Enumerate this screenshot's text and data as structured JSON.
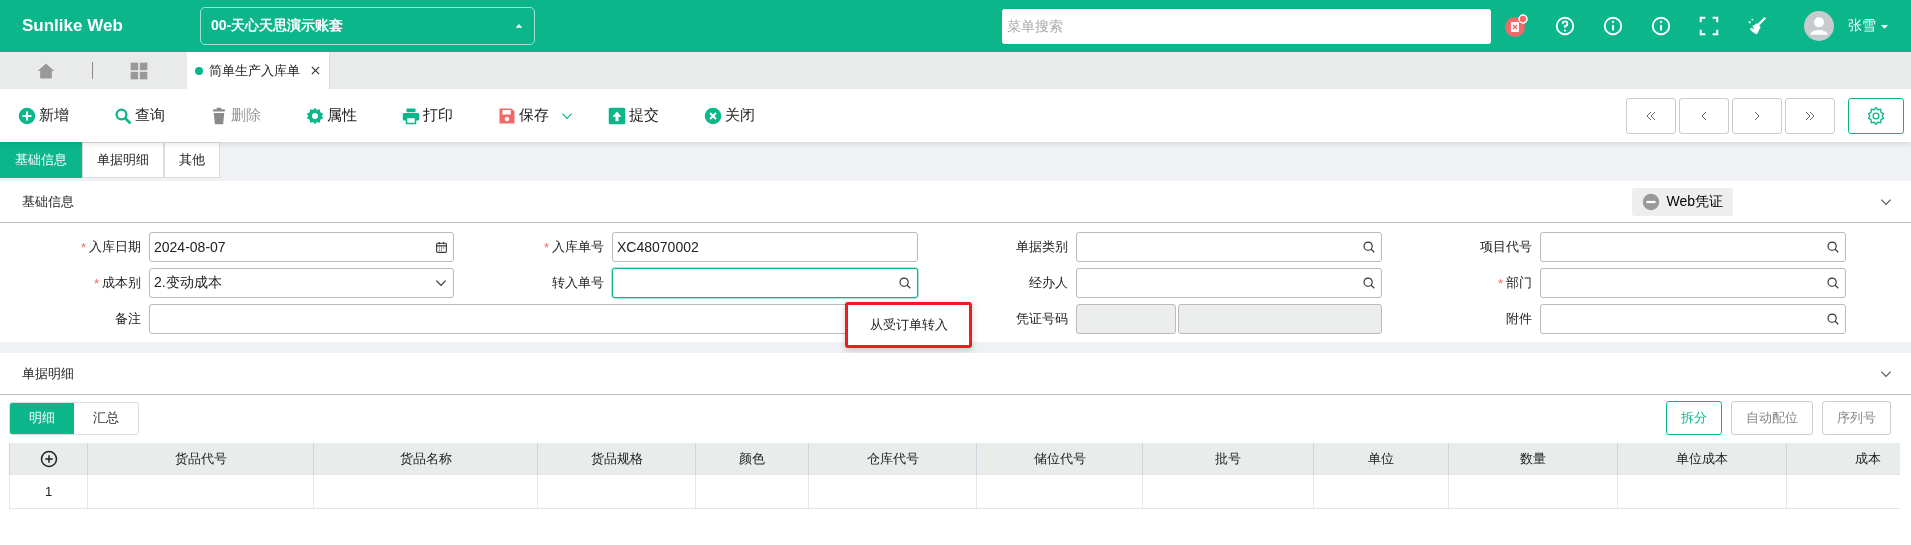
{
  "header": {
    "logo": "Sunlike Web",
    "account": "00-天心天思演示账套",
    "search": {
      "placeholder": "菜单搜索"
    },
    "user": "张雪"
  },
  "doc_tabs": [
    {
      "label": "简单生产入库单",
      "selected": true
    }
  ],
  "toolbar": [
    {
      "kind": "add",
      "label": "新增",
      "disabled": false,
      "dropdown": false
    },
    {
      "kind": "query",
      "label": "查询",
      "disabled": false,
      "dropdown": false
    },
    {
      "kind": "delete",
      "label": "删除",
      "disabled": true,
      "dropdown": false
    },
    {
      "kind": "props",
      "label": "属性",
      "disabled": false,
      "dropdown": false
    },
    {
      "kind": "print",
      "label": "打印",
      "disabled": false,
      "dropdown": false
    },
    {
      "kind": "save",
      "label": "保存",
      "disabled": false,
      "dropdown": true
    },
    {
      "kind": "submit",
      "label": "提交",
      "disabled": false,
      "dropdown": false
    },
    {
      "kind": "close",
      "label": "关闭",
      "disabled": false,
      "dropdown": false
    }
  ],
  "form_tabs": [
    {
      "label": "基础信息",
      "selected": true
    },
    {
      "label": "单据明细",
      "selected": false
    },
    {
      "label": "其他",
      "selected": false
    }
  ],
  "basic_section": {
    "title": "基础信息",
    "voucher_button": "Web凭证",
    "expanded": true,
    "fields": [
      {
        "label": "入库日期",
        "kind": "date",
        "required_mark": "*",
        "value": "2024-08-07",
        "focused": false
      },
      {
        "label": "入库单号",
        "kind": "text",
        "required_mark": "*",
        "value": "XC48070002",
        "focused": false
      },
      {
        "label": "单据类别",
        "kind": "lookup",
        "focused": false
      },
      {
        "label": "项目代号",
        "kind": "lookup",
        "focused": false
      },
      {
        "label": "成本别",
        "kind": "select",
        "required_mark": "*",
        "value": "2.变动成本",
        "focused": false
      },
      {
        "label": "转入单号",
        "kind": "lookup",
        "focused": true
      },
      {
        "label": "经办人",
        "kind": "lookup",
        "focused": false
      },
      {
        "label": "部门",
        "kind": "lookup",
        "required_mark": "*",
        "focused": false
      },
      {
        "label": "备注",
        "kind": "wide",
        "focused": false
      },
      {
        "label": "凭证号码",
        "kind": "split",
        "focused": false
      },
      {
        "label": "附件",
        "kind": "lookup",
        "focused": false
      }
    ],
    "popup_menu": [
      "从受订单转入"
    ]
  },
  "detail_section": {
    "title": "单据明细",
    "expanded": true,
    "tabs": [
      {
        "label": "明细",
        "selected": true
      },
      {
        "label": "汇总",
        "selected": false
      }
    ],
    "buttons": [
      {
        "label": "拆分",
        "disabled": false
      },
      {
        "label": "自动配位",
        "disabled": true
      },
      {
        "label": "序列号",
        "disabled": true
      }
    ],
    "table": {
      "columns": [
        "货品代号",
        "货品名称",
        "货品规格",
        "颜色",
        "仓库代号",
        "储位代号",
        "批号",
        "单位",
        "数量",
        "单位成本",
        "成本"
      ],
      "rows": [
        {
          "index": "1"
        }
      ]
    }
  }
}
